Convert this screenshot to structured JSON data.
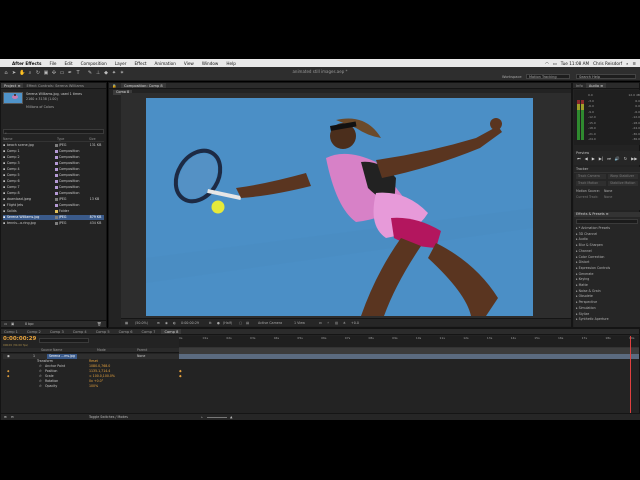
{
  "menubar": {
    "app": "After Effects",
    "items": [
      "File",
      "Edit",
      "Composition",
      "Layer",
      "Effect",
      "Animation",
      "View",
      "Window",
      "Help"
    ],
    "clock": "Tue 11:08 AM",
    "user": "Chris Reisdorf"
  },
  "toolbar": {
    "doc_title": "animated still images.aep *",
    "workspace_label": "Workspace",
    "workspace_value": "Motion Tracking",
    "search_placeholder": "Search Help"
  },
  "project": {
    "tabs": [
      "Project ≡",
      "Effect Controls: Serena Williams"
    ],
    "selected_name": "Serena Williams.jpg",
    "selected_info1": ", used 1 times",
    "selected_info2": "2160 x 3138 (1.00)",
    "selected_info3": "Millions of Colors",
    "columns": [
      "Name",
      "Type",
      "Size"
    ],
    "rows": [
      {
        "name": "beach scene.jpg",
        "type": "JPEG",
        "size": "131 KB",
        "color": "#7d7d7d"
      },
      {
        "name": "Comp 1",
        "type": "Composition",
        "size": "",
        "color": "#b59ad6"
      },
      {
        "name": "Comp 2",
        "type": "Composition",
        "size": "",
        "color": "#b59ad6"
      },
      {
        "name": "Comp 3",
        "type": "Composition",
        "size": "",
        "color": "#b59ad6"
      },
      {
        "name": "Comp 4",
        "type": "Composition",
        "size": "",
        "color": "#b59ad6"
      },
      {
        "name": "Comp 5",
        "type": "Composition",
        "size": "",
        "color": "#b59ad6"
      },
      {
        "name": "Comp 6",
        "type": "Composition",
        "size": "",
        "color": "#b59ad6"
      },
      {
        "name": "Comp 7",
        "type": "Composition",
        "size": "",
        "color": "#b59ad6"
      },
      {
        "name": "Comp 8",
        "type": "Composition",
        "size": "",
        "color": "#b59ad6"
      },
      {
        "name": "download.jpeg",
        "type": "JPEG",
        "size": "13 KB",
        "color": "#7d7d7d"
      },
      {
        "name": "Flight Jets",
        "type": "Composition",
        "size": "",
        "color": "#b59ad6"
      },
      {
        "name": "Solids",
        "type": "Folder",
        "size": "",
        "color": "#e0c05a"
      },
      {
        "name": "Serena Williams.jpg",
        "type": "JPEG",
        "size": "879 KB",
        "color": "#7d7d7d",
        "selected": true
      },
      {
        "name": "tennis...o.ring.jpg",
        "type": "JPEG",
        "size": "434 KB",
        "color": "#7d7d7d"
      }
    ],
    "footer": "8 bpc"
  },
  "composition": {
    "tab": "Composition: Comp 8",
    "subtab": "Comp 8",
    "footer": {
      "zoom": "(50.0%)",
      "timecode": "0:00:00:29",
      "resolution": "(Half)",
      "camera": "Active Camera",
      "view": "1 View",
      "exposure": "+0.0"
    }
  },
  "audio": {
    "tabs": [
      "Info",
      "Audio ≡"
    ],
    "left_levels": [
      "0.0",
      "-3.0",
      "-6.0",
      "-9.0",
      "-12.0",
      "-15.0",
      "-18.0",
      "-21.0",
      "-24.0"
    ],
    "right_levels": [
      "12.0 dB",
      "6.0",
      "0.0",
      "-6.0",
      "-12.0",
      "-18.0",
      "-24.0",
      "-30.0",
      "-36.0"
    ]
  },
  "preview": {
    "title": "Preview"
  },
  "tracker": {
    "title": "Tracker",
    "buttons": [
      "Track Camera",
      "Warp Stabilizer",
      "Track Motion",
      "Stabilize Motion"
    ],
    "motion_source_label": "Motion Source:",
    "motion_source_value": "None",
    "current_track_label": "Current Track:",
    "current_track_value": "None"
  },
  "effects": {
    "title": "Effects & Presets ≡",
    "items": [
      "* Animation Presets",
      "3D Channel",
      "Audio",
      "Blur & Sharpen",
      "Channel",
      "Color Correction",
      "Distort",
      "Expression Controls",
      "Generate",
      "Keying",
      "Matte",
      "Noise & Grain",
      "Obsolete",
      "Perspective",
      "Simulation",
      "Stylize",
      "Synthetic Aperture"
    ]
  },
  "timeline": {
    "tabs": [
      "Comp 1",
      "Comp 2",
      "Comp 3",
      "Comp 4",
      "Comp 5",
      "Comp 6",
      "Comp 7",
      "Comp 8"
    ],
    "timecode": "0:00:00:29",
    "timecode_sub": "00029 (30.00 fps)",
    "col_source": "Source Name",
    "col_mode": "Mode",
    "col_parent": "Parent",
    "layer_name": "Serena ...ms.jpg",
    "layer_parent": "None",
    "transform_label": "Transform",
    "reset_label": "Reset",
    "properties": [
      {
        "name": "Anchor Point",
        "value": "1080.0,768.0",
        "keyed": false
      },
      {
        "name": "Position",
        "value": "1135.1,714.4",
        "keyed": true
      },
      {
        "name": "Scale",
        "value": "∞ 100.0,100.0%",
        "keyed": true
      },
      {
        "name": "Rotation",
        "value": "0x +0.0°",
        "keyed": false
      },
      {
        "name": "Opacity",
        "value": "100%",
        "keyed": false
      }
    ],
    "ruler": [
      "0s",
      "01s",
      "02s",
      "03s",
      "04s",
      "05s",
      "06s",
      "07s",
      "08s",
      "09s",
      "10s",
      "11s",
      "12s",
      "13s",
      "14s",
      "15s",
      "16s",
      "17s",
      "18s",
      "19s"
    ],
    "footer": "Toggle Switches / Modes"
  },
  "colors": {
    "accent_blue": "#4f93c9",
    "timecode_orange": "#e6a23c",
    "selection": "#3a5a8a",
    "keyframe_text": "#e8a33e"
  }
}
